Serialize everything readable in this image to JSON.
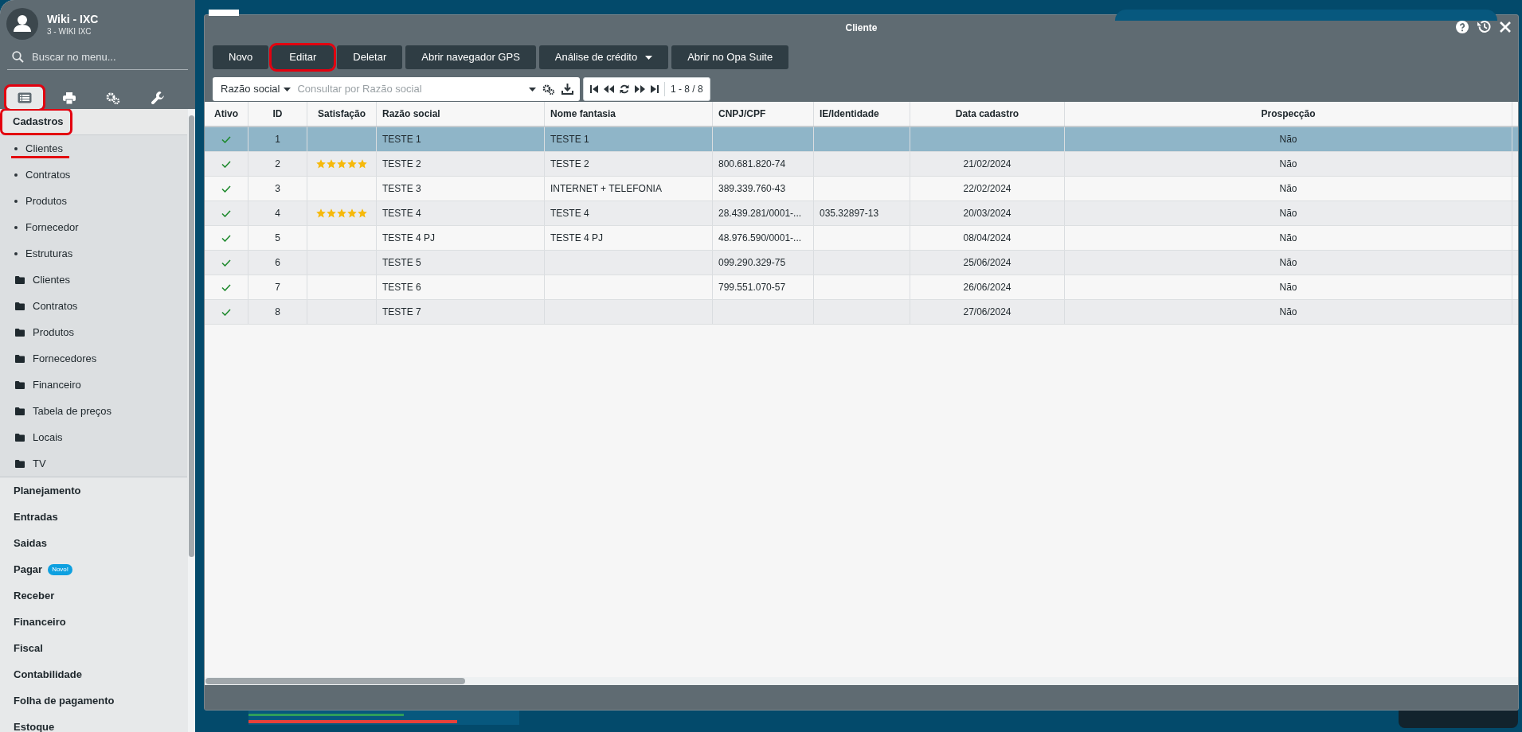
{
  "sidebar": {
    "user": {
      "name": "Wiki - IXC",
      "subtitle": "3 - WIKI IXC"
    },
    "search": {
      "placeholder": "Buscar no menu..."
    },
    "tabs": [
      {
        "kind": "list",
        "selected": true,
        "highlighted": true
      },
      {
        "kind": "print",
        "selected": false,
        "highlighted": false
      },
      {
        "kind": "gears",
        "selected": false,
        "highlighted": false
      },
      {
        "kind": "wrench",
        "selected": false,
        "highlighted": false
      }
    ],
    "sections": [
      {
        "label": "Cadastros",
        "expanded": true,
        "highlighted": true,
        "children": [
          {
            "kind": "link",
            "label": "Clientes",
            "underlined": true
          },
          {
            "kind": "link",
            "label": "Contratos",
            "underlined": false
          },
          {
            "kind": "link",
            "label": "Produtos",
            "underlined": false
          },
          {
            "kind": "link",
            "label": "Fornecedor",
            "underlined": false
          },
          {
            "kind": "link",
            "label": "Estruturas",
            "underlined": false
          },
          {
            "kind": "folder",
            "label": "Clientes",
            "underlined": false
          },
          {
            "kind": "folder",
            "label": "Contratos",
            "underlined": false
          },
          {
            "kind": "folder",
            "label": "Produtos",
            "underlined": false
          },
          {
            "kind": "folder",
            "label": "Fornecedores",
            "underlined": false
          },
          {
            "kind": "folder",
            "label": "Financeiro",
            "underlined": false
          },
          {
            "kind": "folder",
            "label": "Tabela de preços",
            "underlined": false
          },
          {
            "kind": "folder",
            "label": "Locais",
            "underlined": false
          },
          {
            "kind": "folder",
            "label": "TV",
            "underlined": false
          }
        ]
      },
      {
        "label": "Planejamento",
        "expanded": false,
        "highlighted": false
      },
      {
        "label": "Entradas",
        "expanded": false,
        "highlighted": false
      },
      {
        "label": "Saidas",
        "expanded": false,
        "highlighted": false
      },
      {
        "label": "Pagar",
        "expanded": false,
        "highlighted": false,
        "badge": "Novo!"
      },
      {
        "label": "Receber",
        "expanded": false,
        "highlighted": false
      },
      {
        "label": "Financeiro",
        "expanded": false,
        "highlighted": false
      },
      {
        "label": "Fiscal",
        "expanded": false,
        "highlighted": false
      },
      {
        "label": "Contabilidade",
        "expanded": false,
        "highlighted": false
      },
      {
        "label": "Folha de pagamento",
        "expanded": false,
        "highlighted": false
      },
      {
        "label": "Estoque",
        "expanded": false,
        "highlighted": false
      }
    ]
  },
  "window": {
    "title": "Cliente",
    "buttons": [
      {
        "label": "Novo",
        "highlighted": false,
        "dropdown": false
      },
      {
        "label": "Editar",
        "highlighted": true,
        "dropdown": false
      },
      {
        "label": "Deletar",
        "highlighted": false,
        "dropdown": false
      },
      {
        "label": "Abrir navegador GPS",
        "highlighted": false,
        "dropdown": false
      },
      {
        "label": "Análise de crédito",
        "highlighted": false,
        "dropdown": true
      },
      {
        "label": "Abrir no Opa Suite",
        "highlighted": false,
        "dropdown": false
      }
    ],
    "search": {
      "field": "Razão social",
      "placeholder": "Consultar por Razão social"
    },
    "pager": "1 - 8 / 8",
    "table": {
      "columns": [
        {
          "label": "Ativo"
        },
        {
          "label": "ID"
        },
        {
          "label": "Satisfação"
        },
        {
          "label": "Razão social"
        },
        {
          "label": "Nome fantasia"
        },
        {
          "label": "CNPJ/CPF"
        },
        {
          "label": "IE/Identidade"
        },
        {
          "label": "Data cadastro"
        },
        {
          "label": "Prospecção"
        }
      ],
      "rows": [
        {
          "selected": true,
          "active": true,
          "id": "1",
          "razao_social": "TESTE 1",
          "nome_fantasia": "TESTE 1",
          "prospeccao": "Não"
        },
        {
          "selected": false,
          "active": true,
          "id": "2",
          "stars": 5,
          "razao_social": "TESTE 2",
          "nome_fantasia": "TESTE 2",
          "cnpj_cpf": "800.681.820-74",
          "data_cadastro": "21/02/2024",
          "prospeccao": "Não"
        },
        {
          "selected": false,
          "active": true,
          "id": "3",
          "razao_social": "TESTE 3",
          "nome_fantasia": "INTERNET + TELEFONIA",
          "cnpj_cpf": "389.339.760-43",
          "data_cadastro": "22/02/2024",
          "prospeccao": "Não"
        },
        {
          "selected": false,
          "active": true,
          "id": "4",
          "stars": 5,
          "razao_social": "TESTE 4",
          "nome_fantasia": "TESTE 4",
          "cnpj_cpf": "28.439.281/0001-...",
          "ie_identidade": "035.32897-13",
          "data_cadastro": "20/03/2024",
          "prospeccao": "Não"
        },
        {
          "selected": false,
          "active": true,
          "id": "5",
          "razao_social": "TESTE 4 PJ",
          "nome_fantasia": "TESTE 4 PJ",
          "cnpj_cpf": "48.976.590/0001-...",
          "data_cadastro": "08/04/2024",
          "prospeccao": "Não"
        },
        {
          "selected": false,
          "active": true,
          "id": "6",
          "razao_social": "TESTE 5",
          "cnpj_cpf": "099.290.329-75",
          "data_cadastro": "25/06/2024",
          "prospeccao": "Não"
        },
        {
          "selected": false,
          "active": true,
          "id": "7",
          "razao_social": "TESTE 6",
          "cnpj_cpf": "799.551.070-57",
          "data_cadastro": "26/06/2024",
          "prospeccao": "Não"
        },
        {
          "selected": false,
          "active": true,
          "id": "8",
          "razao_social": "TESTE 7",
          "data_cadastro": "27/06/2024",
          "prospeccao": "Não"
        }
      ]
    }
  }
}
